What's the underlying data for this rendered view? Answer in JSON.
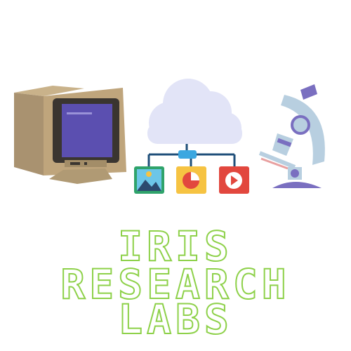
{
  "logo": {
    "lines": [
      "IRIS",
      "RESEARCH",
      "LABS"
    ],
    "stroke_color": "#8ed14a"
  },
  "icons": [
    {
      "name": "retro-computer-icon"
    },
    {
      "name": "cloud-network-icon"
    },
    {
      "name": "image-file-icon",
      "color": "#2fa36b"
    },
    {
      "name": "pie-chart-file-icon",
      "color": "#f6c342"
    },
    {
      "name": "video-file-icon",
      "color": "#e2473e"
    },
    {
      "name": "microscope-icon"
    }
  ]
}
